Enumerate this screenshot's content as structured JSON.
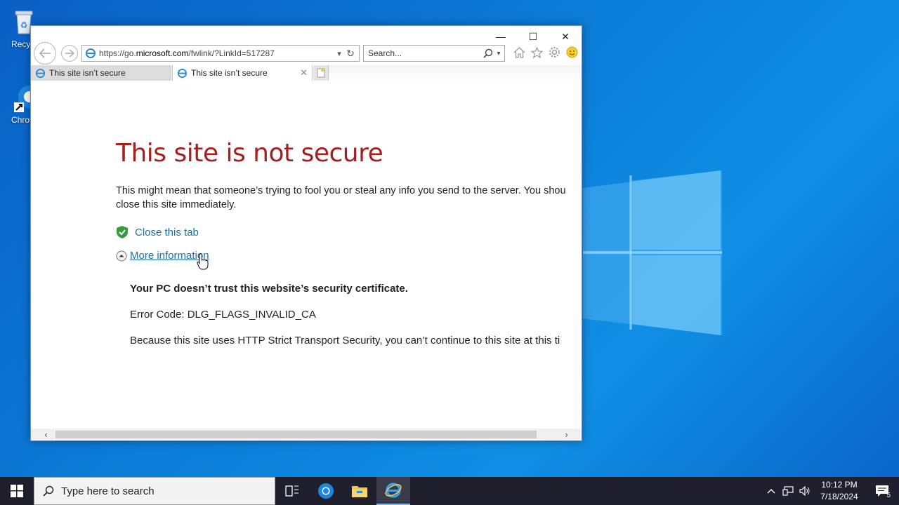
{
  "desktop": {
    "icons": [
      {
        "label": "Recycl",
        "icon": "recycle-bin-icon"
      },
      {
        "label": "Chrom",
        "icon": "chrome-icon"
      }
    ]
  },
  "browser": {
    "title_controls": {
      "minimize": "—",
      "maximize": "☐",
      "close": "✕"
    },
    "address": {
      "prefix": "https://go.",
      "domain": "microsoft.com",
      "path": "/fwlink/?LinkId=517287"
    },
    "search": {
      "placeholder": "Search..."
    },
    "tabs": [
      {
        "label": "This site isn’t secure",
        "active": false
      },
      {
        "label": "This site isn’t secure",
        "active": true
      }
    ],
    "page": {
      "title": "This site is not secure",
      "description": "This might mean that someone’s trying to fool you or steal any info you send to the server. You shou close this site immediately.",
      "description_line1": "This might mean that someone’s trying to fool you or steal any info you send to the server. You shou",
      "description_line2": "close this site immediately.",
      "close_tab_label": "Close this tab",
      "more_info_label": "More information",
      "detail_heading": "Your PC doesn’t trust this website’s security certificate.",
      "error_code": "Error Code: DLG_FLAGS_INVALID_CA",
      "hsts_text": "Because this site uses HTTP Strict Transport Security, you can’t continue to this site at this ti"
    }
  },
  "taskbar": {
    "search_placeholder": "Type here to search",
    "clock_time": "10:12 PM",
    "clock_date": "7/18/2024",
    "notification_count": "5"
  },
  "colors": {
    "title_red": "#a51f1f",
    "link_blue": "#1a6fa9",
    "desktop_blue": "#0b7ed8",
    "taskbar": "#1f1f2e"
  }
}
